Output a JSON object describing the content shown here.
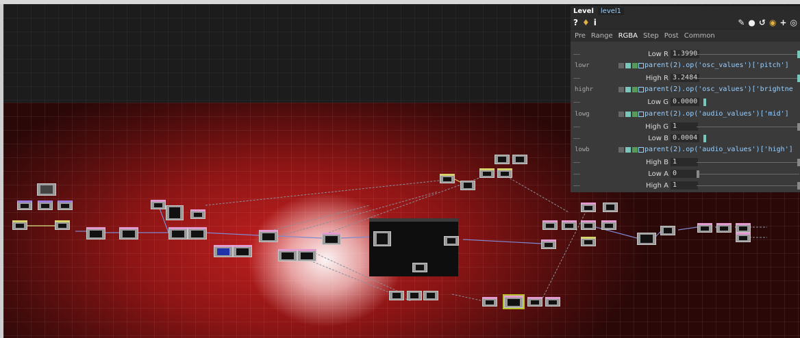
{
  "parameter_panel": {
    "op_type": "Level",
    "op_name": "level1",
    "tools": {
      "help": "?",
      "info": "i"
    },
    "tabs": [
      "Pre",
      "Range",
      "RGBA",
      "Step",
      "Post",
      "Common"
    ],
    "active_tab": "RGBA",
    "rows": {
      "low_r": {
        "label": "Low R",
        "value": "1.3990",
        "key": ""
      },
      "lowr": {
        "key": "lowr",
        "expr": "parent(2).op('osc_values')['pitch']"
      },
      "high_r": {
        "label": "High R",
        "value": "3.2484"
      },
      "highr": {
        "key": "highr",
        "expr": "parent(2).op('osc_values')['brightne"
      },
      "low_g": {
        "label": "Low G",
        "value": "0.0000"
      },
      "lowg": {
        "key": "lowg",
        "expr": "parent(2).op('audio_values')['mid']"
      },
      "high_g": {
        "label": "High G",
        "value": "1"
      },
      "low_b": {
        "label": "Low B",
        "value": "0.0004"
      },
      "lowb": {
        "key": "lowb",
        "expr": "parent(2).op('audio_values')['high']"
      },
      "high_b": {
        "label": "High B",
        "value": "1"
      },
      "low_a": {
        "label": "Low A",
        "value": "0"
      },
      "high_a": {
        "label": "High A",
        "value": "1"
      }
    },
    "accent_color": "#77c8b8",
    "expr_color": "#9ad0ff"
  },
  "network_editor": {
    "background_color": "#c22020",
    "grid": true
  }
}
